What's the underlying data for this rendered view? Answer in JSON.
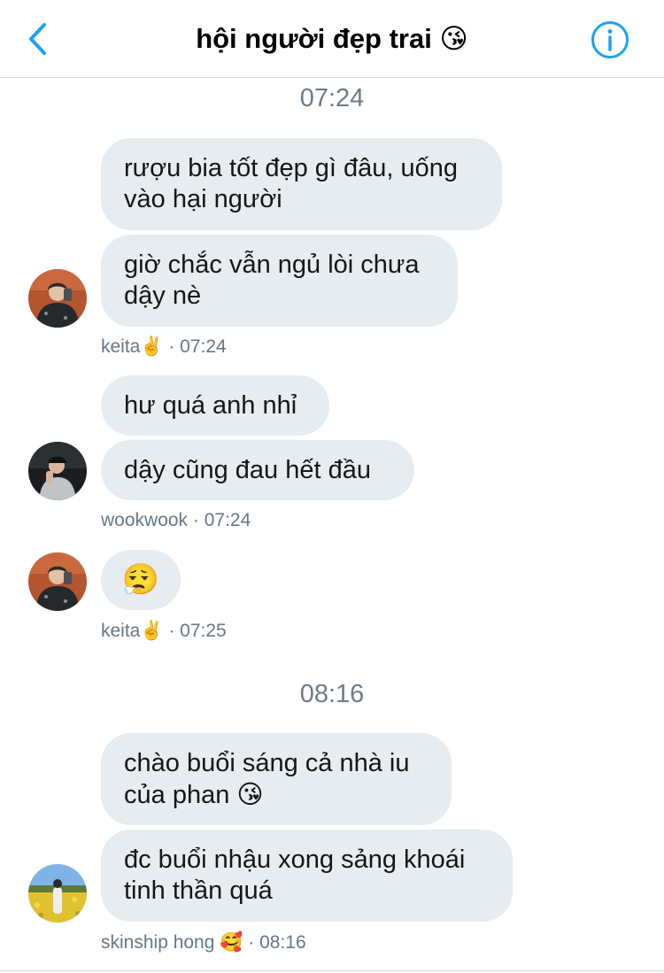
{
  "header": {
    "title": "hội người đẹp trai",
    "title_emoji": "😘",
    "back_icon": "chevron-left-icon",
    "info_icon": "info-circle-icon",
    "accent_color": "#1da1f2"
  },
  "timestamps": [
    "07:24",
    "08:16"
  ],
  "messages": [
    {
      "text": "rượu bia tốt đẹp gì đâu, uống\nvào hại người"
    },
    {
      "text": "giờ chắc vẫn ngủ lòi chưa\ndậy nè"
    },
    {
      "text": "hư quá anh nhỉ"
    },
    {
      "text": "dậy cũng đau hết đầu"
    },
    {
      "text": "",
      "emoji": "😮‍💨"
    },
    {
      "text": "chào buổi sáng cả nhà iu\ncủa phan",
      "emoji": "😘"
    },
    {
      "text": "đc buổi nhậu xong sảng khoái\ntinh thần quá"
    }
  ],
  "meta": [
    {
      "name": "keita",
      "emoji": "✌️",
      "time": "· 07:24"
    },
    {
      "name": "wookwook",
      "emoji": "",
      "time": "· 07:24"
    },
    {
      "name": "keita",
      "emoji": "✌️",
      "time": "· 07:25"
    },
    {
      "name": "skinship hong",
      "emoji": "🥰",
      "time": "· 08:16"
    }
  ],
  "colors": {
    "bubble": "#e6ecf0",
    "timestamp": "#6e7b86",
    "meta": "#657786"
  }
}
